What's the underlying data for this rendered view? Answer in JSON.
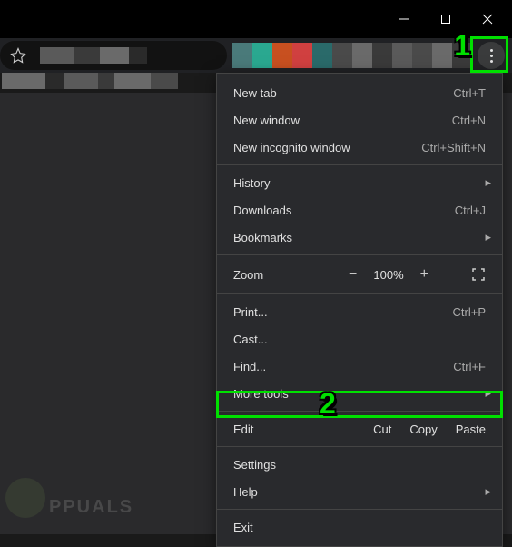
{
  "titlebar": {
    "minimize": "—",
    "maximize": "▢",
    "close": "✕"
  },
  "menu": {
    "new_tab": {
      "label": "New tab",
      "shortcut": "Ctrl+T"
    },
    "new_window": {
      "label": "New window",
      "shortcut": "Ctrl+N"
    },
    "new_incognito": {
      "label": "New incognito window",
      "shortcut": "Ctrl+Shift+N"
    },
    "history": {
      "label": "History"
    },
    "downloads": {
      "label": "Downloads",
      "shortcut": "Ctrl+J"
    },
    "bookmarks": {
      "label": "Bookmarks"
    },
    "zoom": {
      "label": "Zoom",
      "value": "100%",
      "minus": "−",
      "plus": "+"
    },
    "print": {
      "label": "Print...",
      "shortcut": "Ctrl+P"
    },
    "cast": {
      "label": "Cast..."
    },
    "find": {
      "label": "Find...",
      "shortcut": "Ctrl+F"
    },
    "more_tools": {
      "label": "More tools"
    },
    "edit": {
      "label": "Edit",
      "cut": "Cut",
      "copy": "Copy",
      "paste": "Paste"
    },
    "settings": {
      "label": "Settings"
    },
    "help": {
      "label": "Help"
    },
    "exit": {
      "label": "Exit"
    }
  },
  "annotations": {
    "step1": "1",
    "step2": "2"
  },
  "watermark": "PPUALS"
}
